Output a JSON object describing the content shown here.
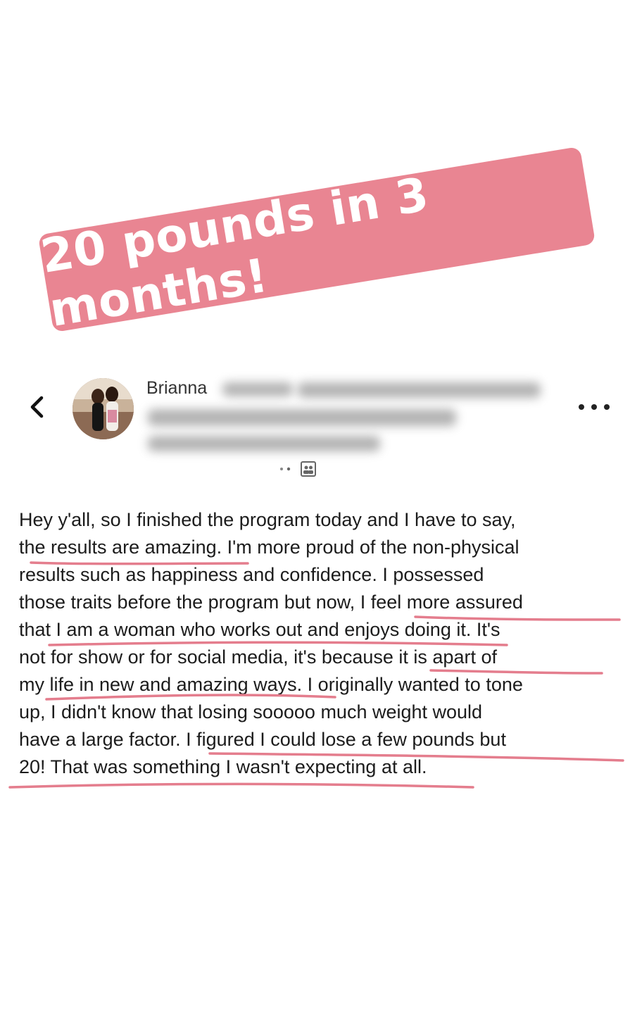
{
  "banner": {
    "text": "20 pounds in 3 months!"
  },
  "post_header": {
    "author_name": "Brianna",
    "more_icon": "more-horizontal-icon",
    "back_icon": "chevron-left-icon"
  },
  "post": {
    "lines": [
      "Hey y'all, so I finished the program today and I have to say,",
      "the results are amazing. I'm more proud of the non-physical",
      "results such as happiness and confidence. I possessed",
      "those traits before the program but now, I feel more assured",
      "that I am a woman who works out and enjoys doing it. It's",
      "not for show or for social media, it's because it is apart of",
      "my life in new and amazing ways. I originally wanted to tone",
      "up, I didn't know that losing sooooo much weight would",
      "have a large factor. I figured I could lose a few pounds but",
      "20! That was something I wasn't expecting at all."
    ]
  },
  "colors": {
    "accent": "#e98592",
    "text": "#1c1c1c"
  }
}
